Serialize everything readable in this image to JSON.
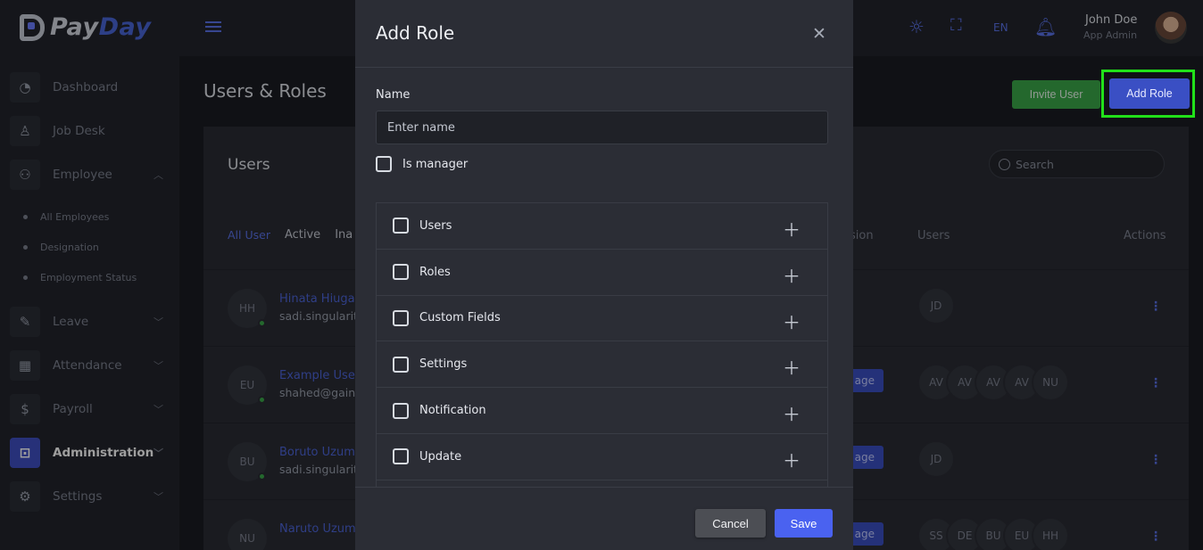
{
  "app": {
    "logo_pay": "Pay",
    "logo_day": "Day"
  },
  "sidebar": {
    "items": [
      {
        "label": "Dashboard",
        "icon": "pie-chart-icon"
      },
      {
        "label": "Job Desk",
        "icon": "user-icon"
      },
      {
        "label": "Employee",
        "icon": "users-icon",
        "expanded": true
      },
      {
        "label": "Leave",
        "icon": "edit-icon"
      },
      {
        "label": "Attendance",
        "icon": "calendar-icon"
      },
      {
        "label": "Payroll",
        "icon": "dollar-icon"
      },
      {
        "label": "Administration",
        "icon": "briefcase-icon",
        "active": true
      },
      {
        "label": "Settings",
        "icon": "gear-icon"
      }
    ],
    "employee_sub": [
      "All Employees",
      "Designation",
      "Employment Status"
    ]
  },
  "topbar": {
    "lang": "EN",
    "user_name": "John Doe",
    "user_role": "App Admin"
  },
  "page": {
    "title": "Users & Roles",
    "invite_btn": "Invite User",
    "add_role_btn": "Add Role"
  },
  "card": {
    "title": "Users",
    "search_placeholder": "Search",
    "tabs": [
      "All User",
      "Active",
      "Ina"
    ],
    "col_permission": "sion",
    "col_users": "Users",
    "col_actions": "Actions",
    "badge_label": "age",
    "rows": [
      {
        "initials": "HH",
        "name": "Hinata Hiuga",
        "email": "sadi.singularity",
        "users": [
          "JD"
        ],
        "badge": false
      },
      {
        "initials": "EU",
        "name": "Example User",
        "email": "shahed@gainn",
        "users": [
          "AV",
          "AV",
          "AV",
          "AV",
          "NU"
        ],
        "badge": true
      },
      {
        "initials": "BU",
        "name": "Boruto Uzuma",
        "email": "sadi.singularity",
        "users": [
          "JD"
        ],
        "badge": true
      },
      {
        "initials": "NU",
        "name": "Naruto Uzuma",
        "email": "",
        "users": [
          "SS",
          "DE",
          "BU",
          "EU",
          "HH"
        ],
        "badge": true
      }
    ]
  },
  "modal": {
    "title": "Add Role",
    "name_label": "Name",
    "name_placeholder": "Enter name",
    "is_manager_label": "Is manager",
    "permissions": [
      "Users",
      "Roles",
      "Custom Fields",
      "Settings",
      "Notification",
      "Update"
    ],
    "cancel_label": "Cancel",
    "save_label": "Save"
  },
  "colors": {
    "accent": "#4a62f0",
    "success": "#3aa94a",
    "highlight": "#22e11a"
  }
}
